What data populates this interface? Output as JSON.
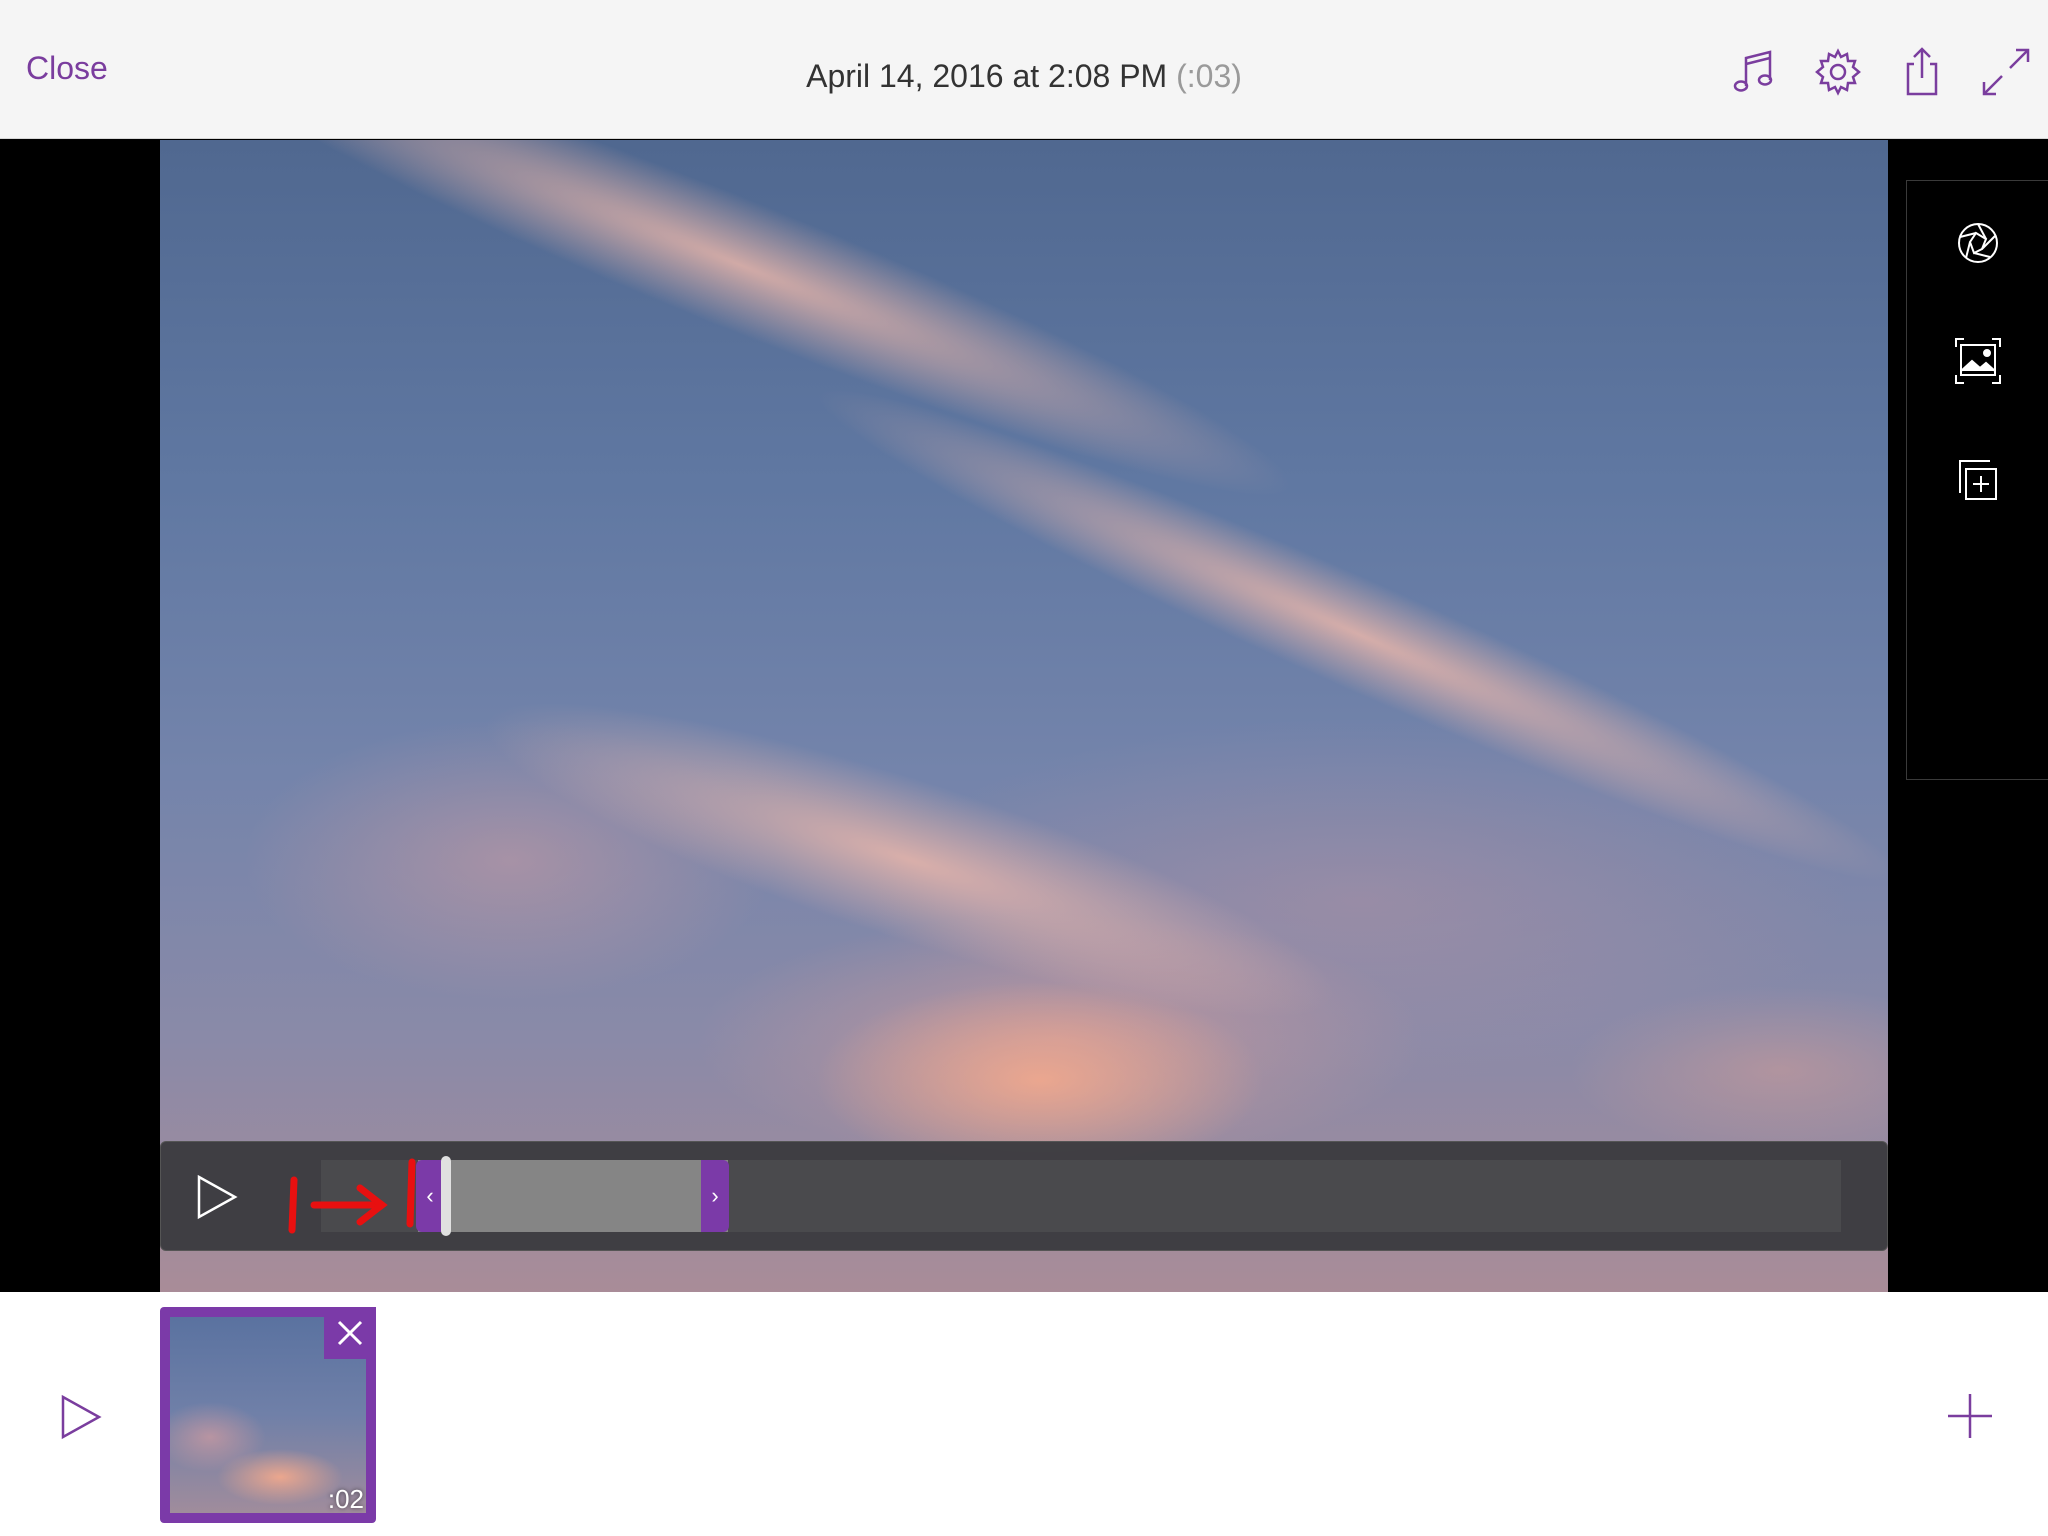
{
  "header": {
    "close_label": "Close",
    "title": "April 14, 2016 at 2:08 PM",
    "duration": "(:03)",
    "icons": [
      "music-note-icon",
      "gear-icon",
      "share-icon",
      "fullscreen-icon"
    ]
  },
  "side_tools": {
    "icons": [
      "filter-aperture-icon",
      "photo-frame-icon",
      "duplicate-add-icon"
    ]
  },
  "trim": {
    "handle_left_glyph": "‹",
    "handle_right_glyph": "›"
  },
  "storyboard": {
    "clips": [
      {
        "duration": ":02"
      }
    ]
  },
  "colors": {
    "accent": "#7b3aa8",
    "topbar_bg": "#f5f5f5",
    "annotation_red": "#e81010"
  }
}
